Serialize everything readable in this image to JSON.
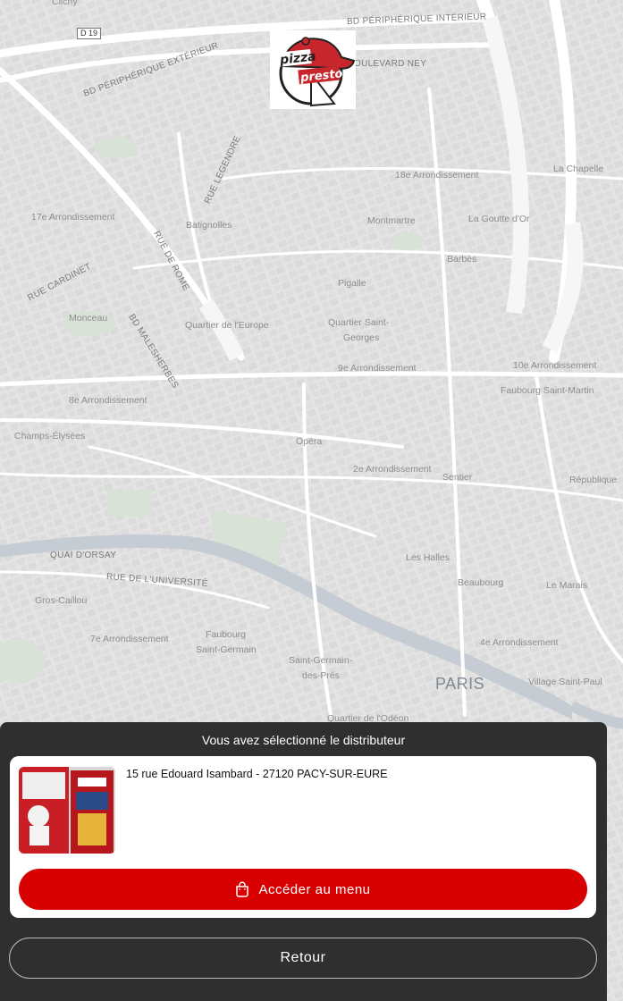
{
  "map": {
    "labels": {
      "clichy": "Clichy",
      "d19": "D 19",
      "bd_peri_int": "BD PÉRIPHÉRIQUE INTÉRIEUR",
      "bd_peri_ext": "BD PÉRIPHÉRIQUE EXTÉRIEUR",
      "bd_ney": "OULEVARD NEY",
      "la_chapelle": "La Chapelle",
      "rue_legendre": "RUE LEGENDRE",
      "arr18": "18e Arrondissement",
      "arr17": "17e Arrondissement",
      "batignolles": "Batignolles",
      "montmartre": "Montmartre",
      "goutte_dor": "La Goutte d'Or",
      "rue_de_rome": "RUE DE ROME",
      "barbes": "Barbès",
      "rue_cardinet": "RUE CARDINET",
      "pigalle": "Pigalle",
      "monceau": "Monceau",
      "bd_malesherbes": "BD MALESHERBES",
      "quartier_europe": "Quartier de l'Europe",
      "quartier_st_georges_1": "Quartier Saint-",
      "quartier_st_georges_2": "Georges",
      "arr10": "10e Arrondissement",
      "arr9": "9e Arrondissement",
      "faubourg_st_martin": "Faubourg Saint-Martin",
      "arr8": "8e Arrondissement",
      "champs_elysees": "Champs-Élysées",
      "opera": "Opéra",
      "arr2": "2e Arrondissement",
      "sentier": "Sentier",
      "republique": "République",
      "quai_dorsay": "QUAI D'ORSAY",
      "les_halles": "Les Halles",
      "rue_universite": "RUE DE L'UNIVERSITÉ",
      "beaubourg": "Beaubourg",
      "le_marais": "Le Marais",
      "gros_caillou": "Gros-Caillou",
      "faubourg_st_germain_1": "Faubourg",
      "faubourg_st_germain_2": "Saint-Germain",
      "arr7": "7e Arrondissement",
      "arr4": "4e Arrondissement",
      "st_germain_pres_1": "Saint-Germain-",
      "st_germain_pres_2": "des-Prés",
      "paris": "PARIS",
      "village_st_paul": "Village Saint-Paul",
      "quartier_odeon": "Quartier de l'Odéon"
    },
    "colors": {
      "background": "#ebebeb",
      "water": "#c5ccd3",
      "park": "#d9e2d7",
      "road": "#ffffff"
    }
  },
  "logo": {
    "line1": "pizza",
    "line2": "presto"
  },
  "panel": {
    "title": "Vous avez sélectionné le distributeur",
    "distributor": {
      "address": "15 rue Edouard Isambard - 27120 PACY-SUR-EURE",
      "thumbnail_icon": "vending-machine-photo"
    },
    "menu_button": {
      "label": "Accéder au menu",
      "icon": "shopping-bag-icon"
    },
    "back_button": {
      "label": "Retour"
    },
    "colors": {
      "panel": "#2f2f2f",
      "accent": "#d80000",
      "card": "#ffffff"
    }
  }
}
